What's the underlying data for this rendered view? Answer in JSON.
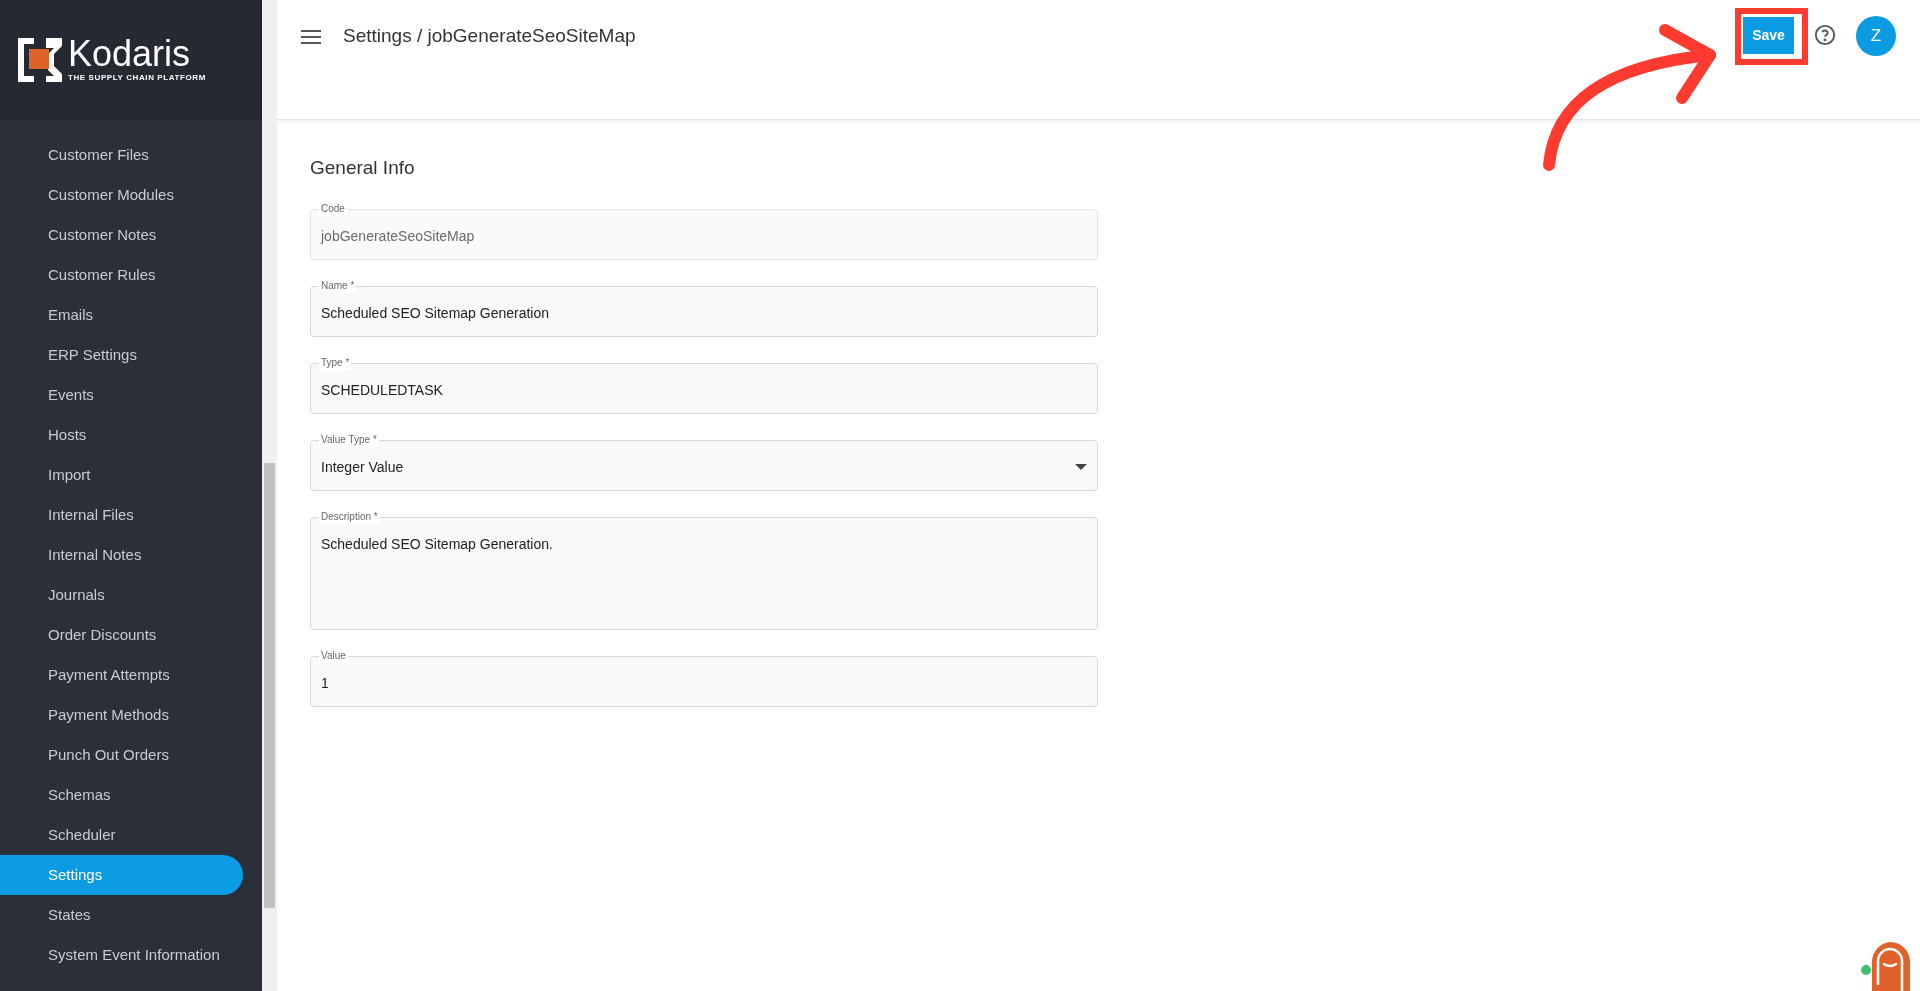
{
  "sidebar": {
    "logo": {
      "name": "Kodaris",
      "tagline": "THE SUPPLY CHAIN PLATFORM"
    },
    "items": [
      {
        "label": "Customer Files",
        "selected": false
      },
      {
        "label": "Customer Modules",
        "selected": false
      },
      {
        "label": "Customer Notes",
        "selected": false
      },
      {
        "label": "Customer Rules",
        "selected": false
      },
      {
        "label": "Emails",
        "selected": false
      },
      {
        "label": "ERP Settings",
        "selected": false
      },
      {
        "label": "Events",
        "selected": false
      },
      {
        "label": "Hosts",
        "selected": false
      },
      {
        "label": "Import",
        "selected": false
      },
      {
        "label": "Internal Files",
        "selected": false
      },
      {
        "label": "Internal Notes",
        "selected": false
      },
      {
        "label": "Journals",
        "selected": false
      },
      {
        "label": "Order Discounts",
        "selected": false
      },
      {
        "label": "Payment Attempts",
        "selected": false
      },
      {
        "label": "Payment Methods",
        "selected": false
      },
      {
        "label": "Punch Out Orders",
        "selected": false
      },
      {
        "label": "Schemas",
        "selected": false
      },
      {
        "label": "Scheduler",
        "selected": false
      },
      {
        "label": "Settings",
        "selected": true
      },
      {
        "label": "States",
        "selected": false
      },
      {
        "label": "System Event Information",
        "selected": false
      }
    ]
  },
  "header": {
    "title": "Settings / jobGenerateSeoSiteMap",
    "save": "Save",
    "avatar": "Z"
  },
  "section_title": "General Info",
  "fields": [
    {
      "kind": "text",
      "label": "Code",
      "value": "jobGenerateSeoSiteMap",
      "disabled": true
    },
    {
      "kind": "text",
      "label": "Name *",
      "value": "Scheduled SEO Sitemap Generation",
      "disabled": false
    },
    {
      "kind": "text",
      "label": "Type *",
      "value": "SCHEDULEDTASK",
      "disabled": false
    },
    {
      "kind": "select",
      "label": "Value Type *",
      "value": "Integer Value",
      "disabled": false
    },
    {
      "kind": "textarea",
      "label": "Description *",
      "value": "Scheduled SEO Sitemap Generation.",
      "disabled": false
    },
    {
      "kind": "text",
      "label": "Value",
      "value": "1",
      "disabled": false
    }
  ]
}
